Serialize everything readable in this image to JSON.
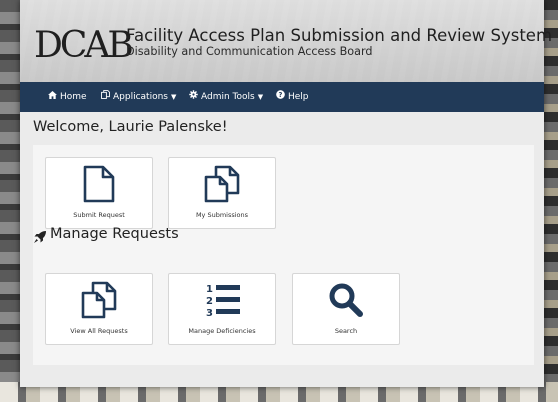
{
  "header": {
    "logo_text": "DCAB",
    "title": "Facility Access Plan Submission and Review System",
    "subtitle": "Disability and Communication Access Board"
  },
  "nav": {
    "items": [
      {
        "label": "Home",
        "icon": "home-icon"
      },
      {
        "label": "Applications",
        "icon": "copy-icon",
        "dropdown": true
      },
      {
        "label": "Admin Tools",
        "icon": "gear-icon",
        "dropdown": true
      },
      {
        "label": "Help",
        "icon": "question-circle-icon"
      }
    ]
  },
  "main": {
    "welcome": "Welcome, Laurie Palenske!",
    "tiles_top": [
      {
        "label": "Submit Request",
        "icon": "document-icon"
      },
      {
        "label": "My Submissions",
        "icon": "copy-icon"
      }
    ],
    "section_title": "Manage Requests",
    "section_icon": "rocket-icon",
    "tiles_manage": [
      {
        "label": "View All Requests",
        "icon": "copy-icon"
      },
      {
        "label": "Manage Deficiencies",
        "icon": "numbered-list-icon"
      },
      {
        "label": "Search",
        "icon": "search-icon"
      }
    ]
  },
  "colors": {
    "nav_bg": "#213a58",
    "icon_color": "#213a58"
  }
}
